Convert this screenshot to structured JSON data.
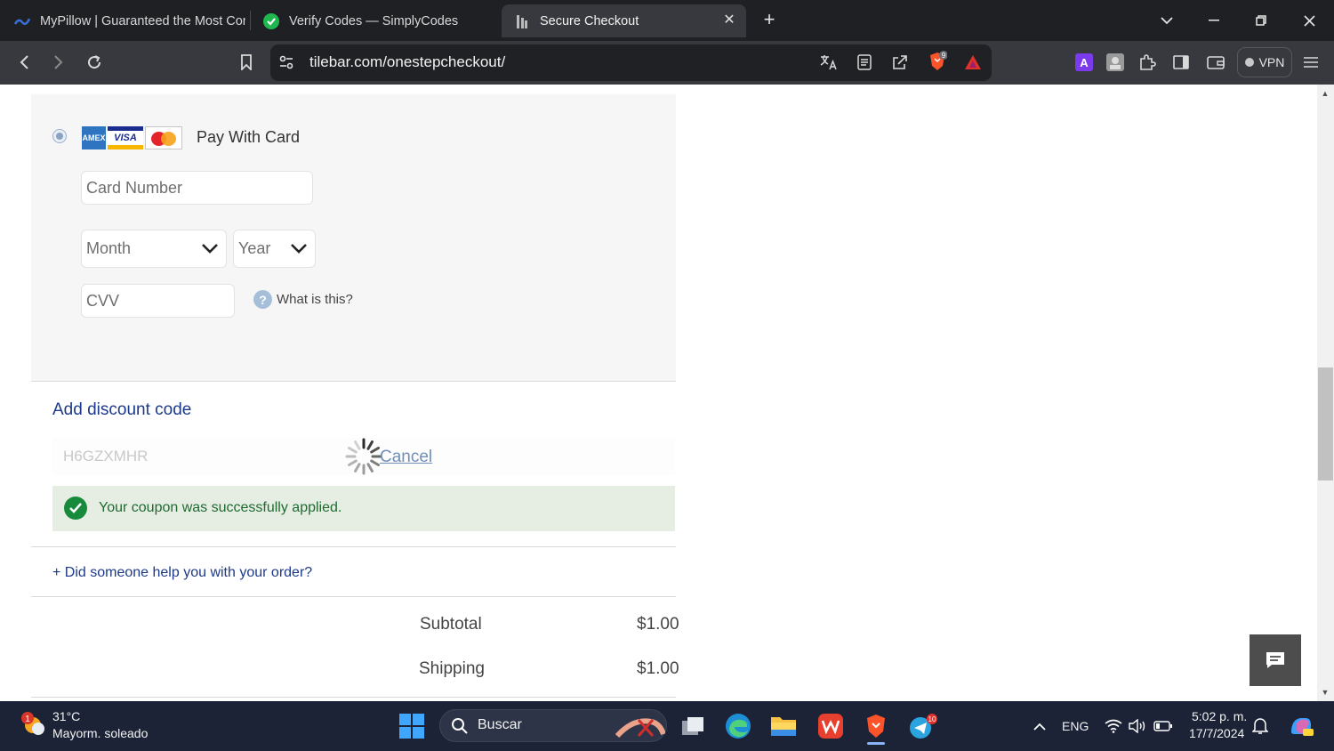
{
  "browser": {
    "tabs": [
      {
        "title": "MyPillow | Guaranteed the Most Con",
        "active": false
      },
      {
        "title": "Verify Codes — SimplyCodes",
        "active": false
      },
      {
        "title": "Secure Checkout",
        "active": true
      }
    ],
    "url": "tilebar.com/onestepcheckout/",
    "vpn_label": "VPN",
    "brave_badge": "9"
  },
  "payment": {
    "method_label": "Pay With Card",
    "card_brands": [
      "amex-icon",
      "visa-icon",
      "mastercard-icon"
    ],
    "card_number_placeholder": "Card Number",
    "month_label": "Month",
    "year_label": "Year",
    "cvv_placeholder": "CVV",
    "cvv_help": "What is this?"
  },
  "discount": {
    "title": "Add discount code",
    "code": "H6GZXMHR",
    "cancel_label": "Cancel",
    "success_message": "Your coupon was successfully applied."
  },
  "helper_link": "+ Did someone help you with your order?",
  "totals": [
    {
      "label": "Subtotal",
      "value": "$1.00"
    },
    {
      "label": "Shipping",
      "value": "$1.00"
    }
  ],
  "taskbar": {
    "weather_temp": "31°C",
    "weather_desc": "Mayorm. soleado",
    "weather_badge": "1",
    "search_label": "Buscar",
    "language": "ENG",
    "time": "5:02 p. m.",
    "date": "17/7/2024",
    "telegram_badge": "10"
  },
  "colors": {
    "link_blue": "#1d3a8a",
    "success_green": "#188a3c",
    "success_bg": "#e6eee4"
  }
}
